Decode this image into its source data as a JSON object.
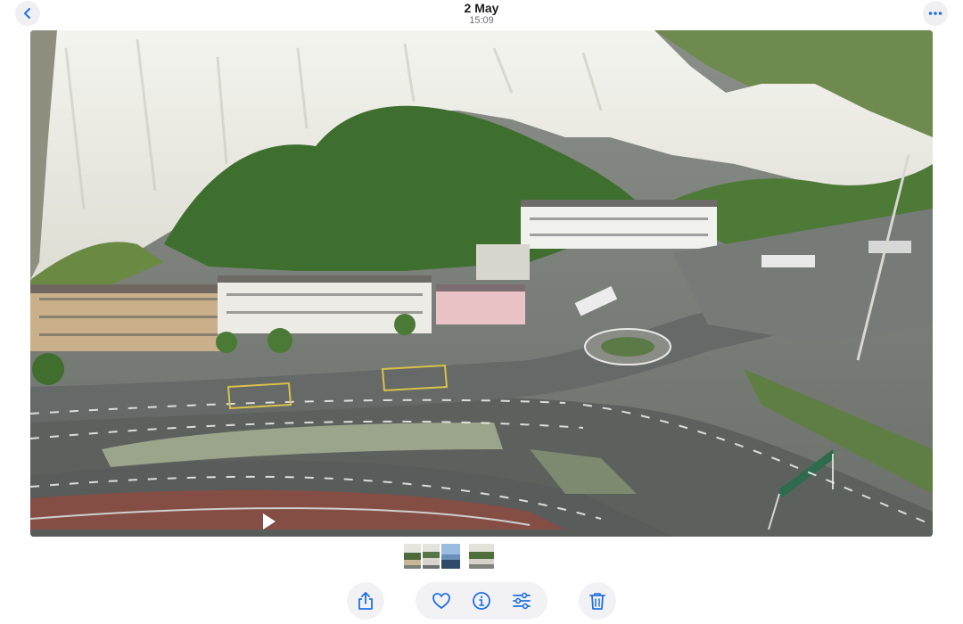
{
  "header": {
    "date": "2 May",
    "time": "15:09",
    "back_icon": "chevron-left-icon",
    "more_icon": "ellipsis-icon"
  },
  "media": {
    "type": "video",
    "description_icon": "play-icon",
    "progress": 0.0
  },
  "thumbnails": {
    "count": 4,
    "selected_index": 2
  },
  "toolbar": {
    "items": [
      "share-icon",
      "heart-icon",
      "info-icon",
      "adjust-icon",
      "trash-icon"
    ]
  },
  "colors": {
    "accent": "#1f6fe5",
    "button_bg": "#f2f2f5"
  }
}
